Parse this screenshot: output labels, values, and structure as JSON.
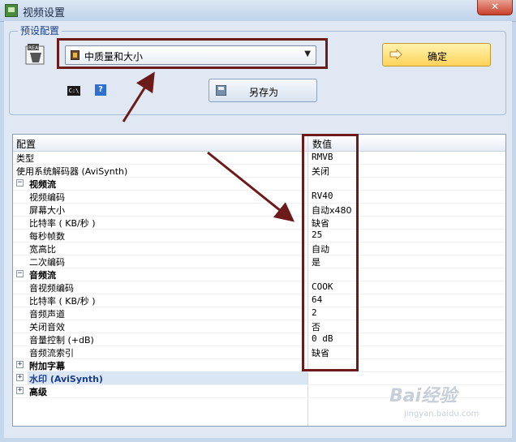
{
  "window": {
    "title": "视频设置",
    "close_label": "✕"
  },
  "preset": {
    "group_title": "预设配置",
    "dropdown_value": "中质量和大小",
    "ok_label": "确定",
    "save_as_label": "另存为",
    "cmd_icon_text": "C:\\",
    "help_icon_text": "?"
  },
  "grid": {
    "header_name": "配置",
    "header_value": "数值",
    "rows": [
      {
        "name": "类型",
        "value": "RMVB"
      },
      {
        "name": "使用系统解码器 (AviSynth)",
        "value": "关闭"
      },
      {
        "name": "视频流",
        "value": ""
      },
      {
        "name": "视频编码",
        "value": "RV40"
      },
      {
        "name": "屏幕大小",
        "value": "自动x480"
      },
      {
        "name": "比特率 ( KB/秒 )",
        "value": "缺省"
      },
      {
        "name": "每秒帧数",
        "value": "25"
      },
      {
        "name": "宽高比",
        "value": "自动"
      },
      {
        "name": "二次编码",
        "value": "是"
      },
      {
        "name": "音频流",
        "value": ""
      },
      {
        "name": "音视频编码",
        "value": "COOK"
      },
      {
        "name": "比特率 ( KB/秒 )",
        "value": "64"
      },
      {
        "name": "音频声道",
        "value": "2"
      },
      {
        "name": "关闭音效",
        "value": "否"
      },
      {
        "name": "音量控制 (+dB)",
        "value": "0 dB"
      },
      {
        "name": "音频流索引",
        "value": "缺省"
      },
      {
        "name": "附加字幕",
        "value": ""
      },
      {
        "name": "水印 (AviSynth)",
        "value": ""
      },
      {
        "name": "高级",
        "value": ""
      }
    ]
  },
  "watermark": {
    "text": "Bai经验",
    "sub": "jingyan.baidu.com"
  },
  "colors": {
    "highlight": "#6d1a1a",
    "ok_button": "#ffd35a",
    "selected_row": "#dbe6f5"
  }
}
